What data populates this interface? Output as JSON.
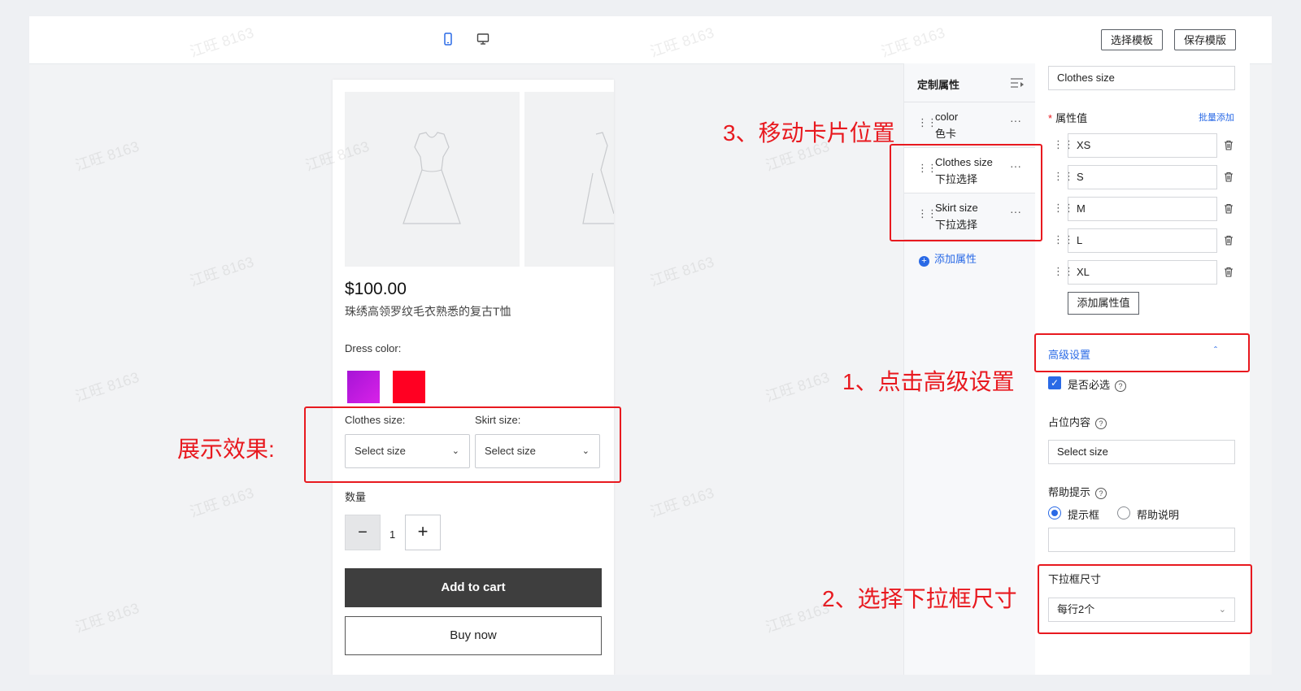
{
  "toolbar": {
    "device_icons": [
      "mobile-icon",
      "desktop-icon"
    ],
    "select_template_label": "选择模板",
    "save_template_label": "保存模版"
  },
  "preview": {
    "price": "$100.00",
    "product_name": "珠绣高领罗纹毛衣熟悉的复古T恤",
    "dress_color_label": "Dress color:",
    "swatch_colors": [
      "#c21be0",
      "#ff0022"
    ],
    "clothes_size_label": "Clothes size:",
    "skirt_size_label": "Skirt size:",
    "clothes_size_value": "Select size",
    "skirt_size_value": "Select size",
    "quantity_label": "数量",
    "quantity_value": "1",
    "minus": "−",
    "plus": "+",
    "add_to_cart": "Add to cart",
    "buy_now": "Buy now"
  },
  "attributes": {
    "title": "定制属性",
    "items": [
      {
        "name": "color",
        "type": "色卡"
      },
      {
        "name": "Clothes size",
        "type": "下拉选择"
      },
      {
        "name": "Skirt size",
        "type": "下拉选择"
      }
    ],
    "add_label": "添加属性"
  },
  "settings": {
    "attribute_name": "Clothes size",
    "values_label": "属性值",
    "required_star": "*",
    "bulk_add": "批量添加",
    "values": [
      "XS",
      "S",
      "M",
      "L",
      "XL"
    ],
    "add_value_label": "添加属性值",
    "advanced_label": "高级设置",
    "required_checkbox_label": "是否必选",
    "required_checked": true,
    "placeholder_label": "占位内容",
    "placeholder_value": "Select size",
    "help_label": "帮助提示",
    "help_options": [
      "提示框",
      "帮助说明"
    ],
    "help_selected": "提示框",
    "help_text_value": "",
    "dropdown_size_label": "下拉框尺寸",
    "dropdown_size_value": "每行2个"
  },
  "annotations": {
    "step3": "3、移动卡片位置",
    "step1": "1、点击高级设置",
    "step2": "2、选择下拉框尺寸",
    "preview_effect": "展示效果:"
  },
  "watermark": "江旺 8163",
  "colors": {
    "annotation_red": "#e8191f",
    "accent_blue": "#2a6ae6",
    "cart_button": "#3e3e3e"
  }
}
